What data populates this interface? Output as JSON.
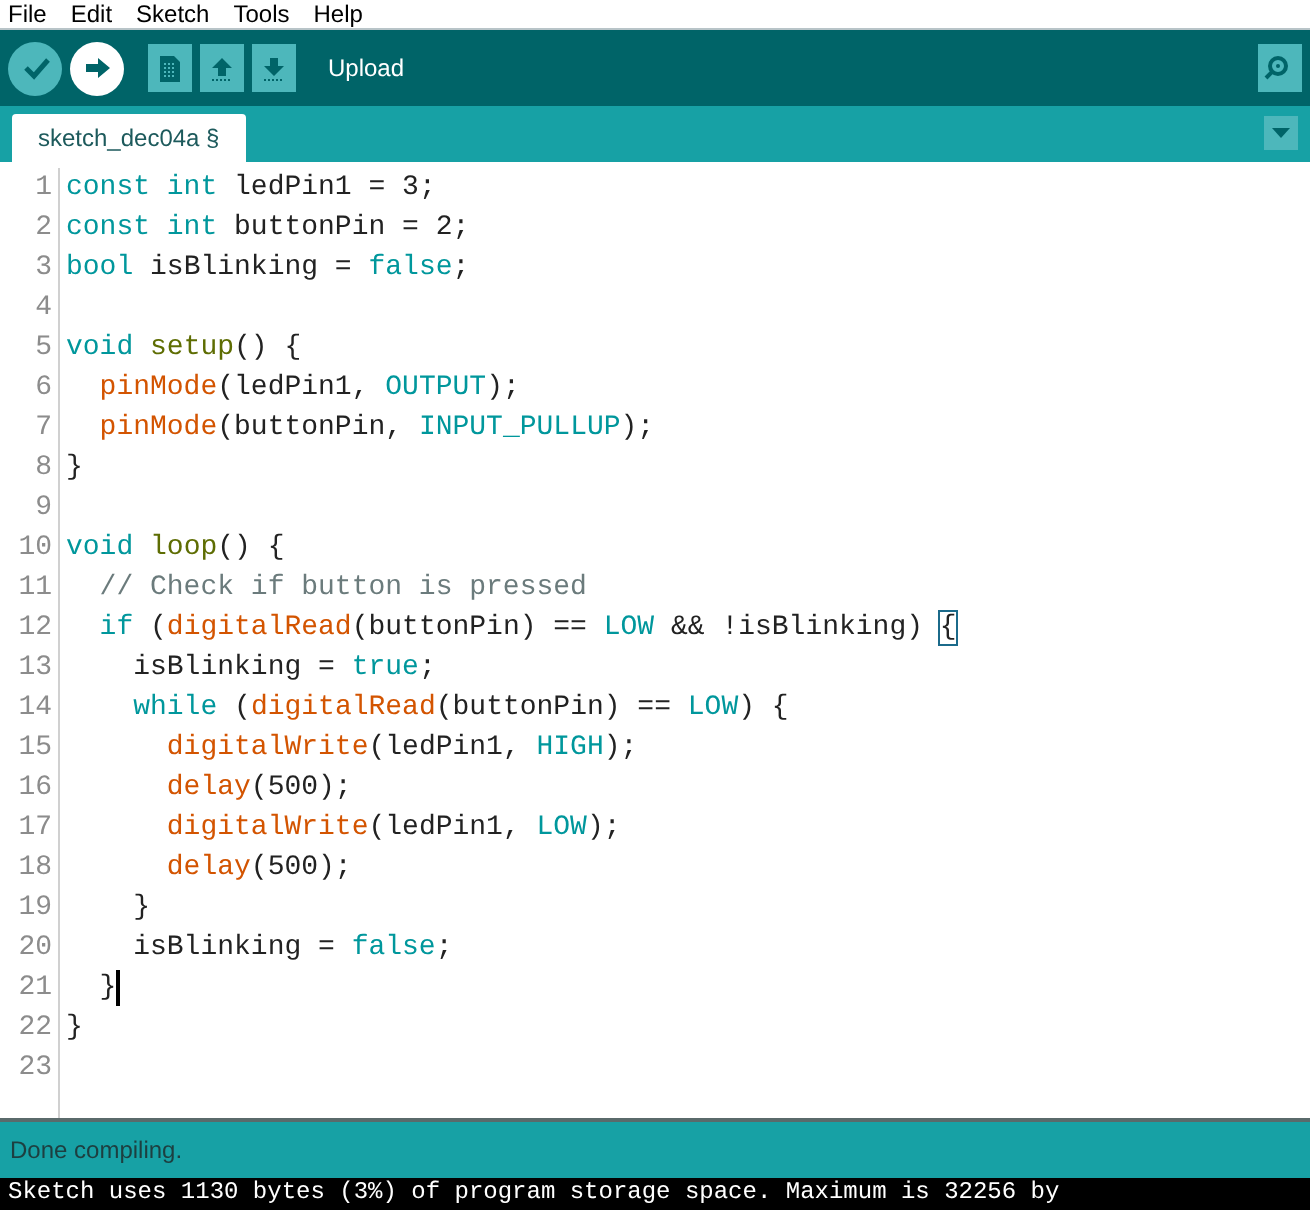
{
  "menu": [
    "File",
    "Edit",
    "Sketch",
    "Tools",
    "Help"
  ],
  "toolbar": {
    "hover_label": "Upload"
  },
  "tabs": [
    {
      "label": "sketch_dec04a §",
      "selected": true
    }
  ],
  "editor": {
    "lines": [
      {
        "number": "1",
        "segments": [
          {
            "kind": "keyword",
            "text": "const int"
          },
          {
            "kind": "plain",
            "text": " ledPin1 = 3;"
          }
        ]
      },
      {
        "number": "2",
        "segments": [
          {
            "kind": "keyword",
            "text": "const int"
          },
          {
            "kind": "plain",
            "text": " buttonPin = 2;"
          }
        ]
      },
      {
        "number": "3",
        "segments": [
          {
            "kind": "keyword",
            "text": "bool"
          },
          {
            "kind": "plain",
            "text": " isBlinking = "
          },
          {
            "kind": "keyword",
            "text": "false"
          },
          {
            "kind": "plain",
            "text": ";"
          }
        ]
      },
      {
        "number": "4"
      },
      {
        "number": "5",
        "segments": [
          {
            "kind": "keyword",
            "text": "void"
          },
          {
            "kind": "structure",
            "text": " setup"
          },
          {
            "kind": "plain",
            "text": "() {"
          }
        ]
      },
      {
        "number": "6",
        "segments": [
          {
            "kind": "function",
            "text": "  pinMode"
          },
          {
            "kind": "plain",
            "text": "(ledPin1, "
          },
          {
            "kind": "keyword",
            "text": "OUTPUT"
          },
          {
            "kind": "plain",
            "text": ");"
          }
        ]
      },
      {
        "number": "7",
        "segments": [
          {
            "kind": "function",
            "text": "  pinMode"
          },
          {
            "kind": "plain",
            "text": "(buttonPin, "
          },
          {
            "kind": "keyword",
            "text": "INPUT_PULLUP"
          },
          {
            "kind": "plain",
            "text": ");"
          }
        ]
      },
      {
        "number": "8",
        "segments": [
          {
            "kind": "plain",
            "text": "}"
          }
        ]
      },
      {
        "number": "9"
      },
      {
        "number": "10",
        "segments": [
          {
            "kind": "keyword",
            "text": "void"
          },
          {
            "kind": "structure",
            "text": " loop"
          },
          {
            "kind": "plain",
            "text": "() {"
          }
        ]
      },
      {
        "number": "11",
        "segments": [
          {
            "kind": "comment",
            "text": "  // Check if button is pressed"
          }
        ]
      },
      {
        "number": "12",
        "segments": [
          {
            "kind": "keyword",
            "text": "  if"
          },
          {
            "kind": "plain",
            "text": " ("
          },
          {
            "kind": "function",
            "text": "digitalRead"
          },
          {
            "kind": "plain",
            "text": "(buttonPin) == "
          },
          {
            "kind": "keyword",
            "text": "LOW"
          },
          {
            "kind": "plain",
            "text": " && !isBlinking) "
          },
          {
            "kind": "bracket_match",
            "text": "{"
          }
        ]
      },
      {
        "number": "13",
        "segments": [
          {
            "kind": "plain",
            "text": "    isBlinking = "
          },
          {
            "kind": "keyword",
            "text": "true"
          },
          {
            "kind": "plain",
            "text": ";"
          }
        ]
      },
      {
        "number": "14",
        "segments": [
          {
            "kind": "keyword",
            "text": "    while"
          },
          {
            "kind": "plain",
            "text": " ("
          },
          {
            "kind": "function",
            "text": "digitalRead"
          },
          {
            "kind": "plain",
            "text": "(buttonPin) == "
          },
          {
            "kind": "keyword",
            "text": "LOW"
          },
          {
            "kind": "plain",
            "text": ") {"
          }
        ]
      },
      {
        "number": "15",
        "segments": [
          {
            "kind": "function",
            "text": "      digitalWrite"
          },
          {
            "kind": "plain",
            "text": "(ledPin1, "
          },
          {
            "kind": "keyword",
            "text": "HIGH"
          },
          {
            "kind": "plain",
            "text": ");"
          }
        ]
      },
      {
        "number": "16",
        "segments": [
          {
            "kind": "function",
            "text": "      delay"
          },
          {
            "kind": "plain",
            "text": "(500);"
          }
        ]
      },
      {
        "number": "17",
        "segments": [
          {
            "kind": "function",
            "text": "      digitalWrite"
          },
          {
            "kind": "plain",
            "text": "(ledPin1, "
          },
          {
            "kind": "keyword",
            "text": "LOW"
          },
          {
            "kind": "plain",
            "text": ");"
          }
        ]
      },
      {
        "number": "18",
        "segments": [
          {
            "kind": "function",
            "text": "      delay"
          },
          {
            "kind": "plain",
            "text": "(500);"
          }
        ]
      },
      {
        "number": "19",
        "segments": [
          {
            "kind": "plain",
            "text": "    }"
          }
        ]
      },
      {
        "number": "20",
        "segments": [
          {
            "kind": "plain",
            "text": "    isBlinking = "
          },
          {
            "kind": "keyword",
            "text": "false"
          },
          {
            "kind": "plain",
            "text": ";"
          }
        ]
      },
      {
        "number": "21",
        "cursor": true,
        "segments": [
          {
            "kind": "plain",
            "text": "  }"
          }
        ]
      },
      {
        "number": "22",
        "segments": [
          {
            "kind": "plain",
            "text": "}"
          }
        ]
      },
      {
        "number": "23"
      }
    ]
  },
  "status_bar": "Done compiling.",
  "console": [
    "Sketch uses 1130 bytes (3%) of program storage space. Maximum is 32256 by"
  ]
}
